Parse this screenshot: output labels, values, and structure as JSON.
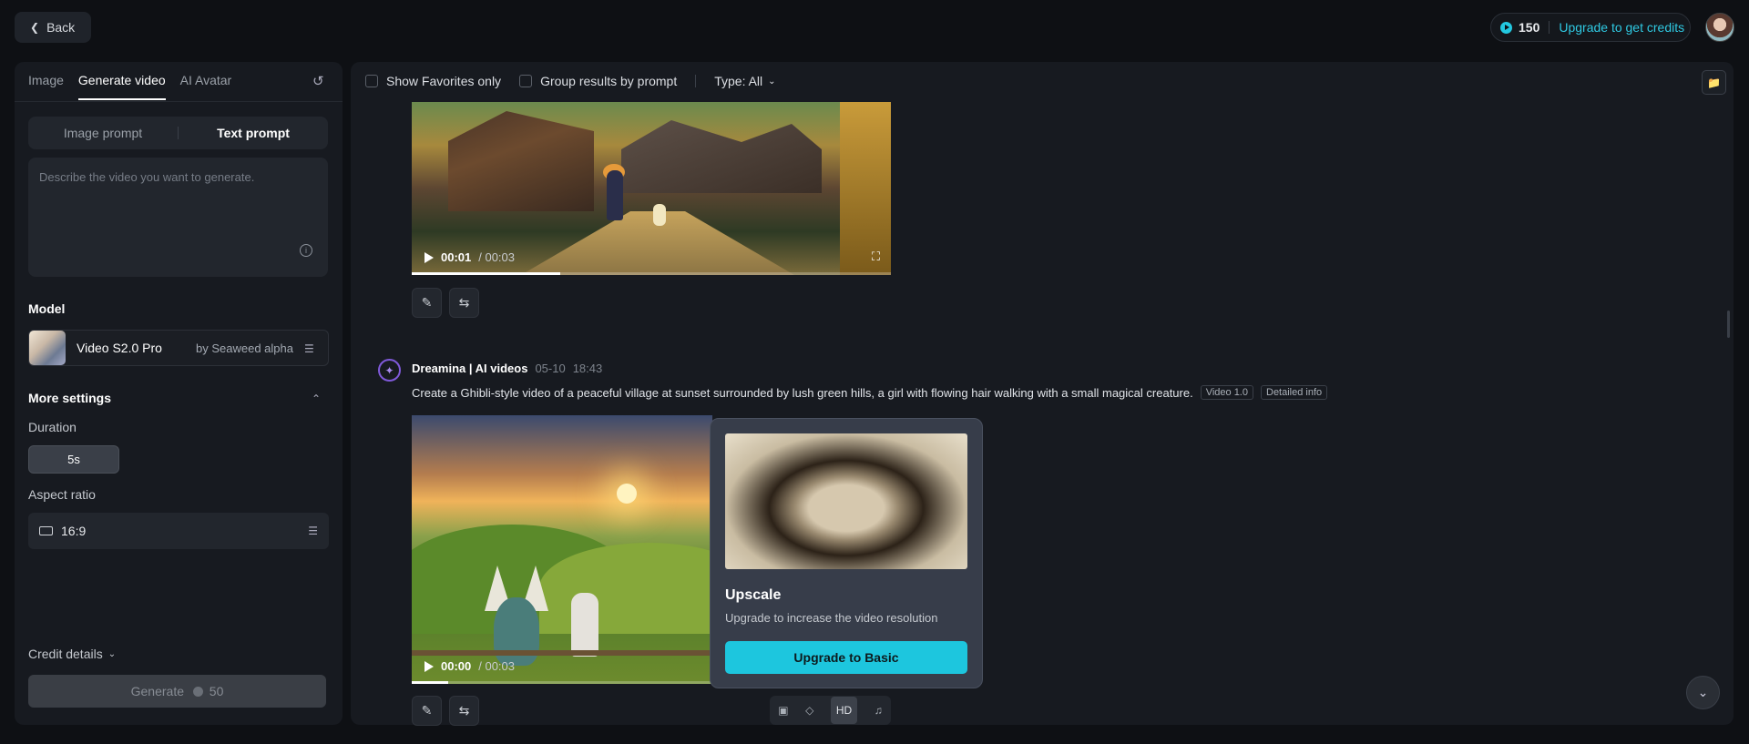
{
  "topbar": {
    "back_label": "Back",
    "credits": "150",
    "upgrade_label": "Upgrade to get credits"
  },
  "left": {
    "tabs": [
      {
        "label": "Image",
        "active": false
      },
      {
        "label": "Generate video",
        "active": true
      },
      {
        "label": "AI Avatar",
        "active": false
      }
    ],
    "prompt_modes": [
      "Image prompt",
      "Text prompt"
    ],
    "prompt_placeholder": "Describe the video you want to generate.",
    "model_label": "Model",
    "model_name": "Video S2.0 Pro",
    "model_by": "by Seaweed alpha",
    "more_settings": "More settings",
    "duration_label": "Duration",
    "duration_value": "5s",
    "aspect_label": "Aspect ratio",
    "aspect_value": "16:9",
    "credit_details": "Credit details",
    "generate_label": "Generate",
    "generate_cost": "50"
  },
  "main": {
    "filters": {
      "favorites": "Show Favorites only",
      "group": "Group results by prompt",
      "type": "Type: All"
    },
    "video1": {
      "current_time": "00:01",
      "total_time": "/ 00:03",
      "progress": 0.31
    },
    "entry": {
      "author": "Dreamina | AI videos",
      "date": "05-10",
      "time": "18:43",
      "prompt": "Create a Ghibli-style video of a peaceful village at sunset surrounded by lush green hills, a girl with flowing hair walking with a small magical creature.",
      "tags": [
        "Video 1.0",
        "Detailed info"
      ]
    },
    "video2": {
      "current_time": "00:00",
      "total_time": "/ 00:03",
      "progress": 0.12
    },
    "popup": {
      "title": "Upscale",
      "subtitle": "Upgrade to increase the video resolution",
      "button": "Upgrade to Basic"
    },
    "toolstrip_hd": "HD"
  },
  "colors": {
    "accent": "#1dc6de",
    "brand_purple": "#7f59d9"
  }
}
